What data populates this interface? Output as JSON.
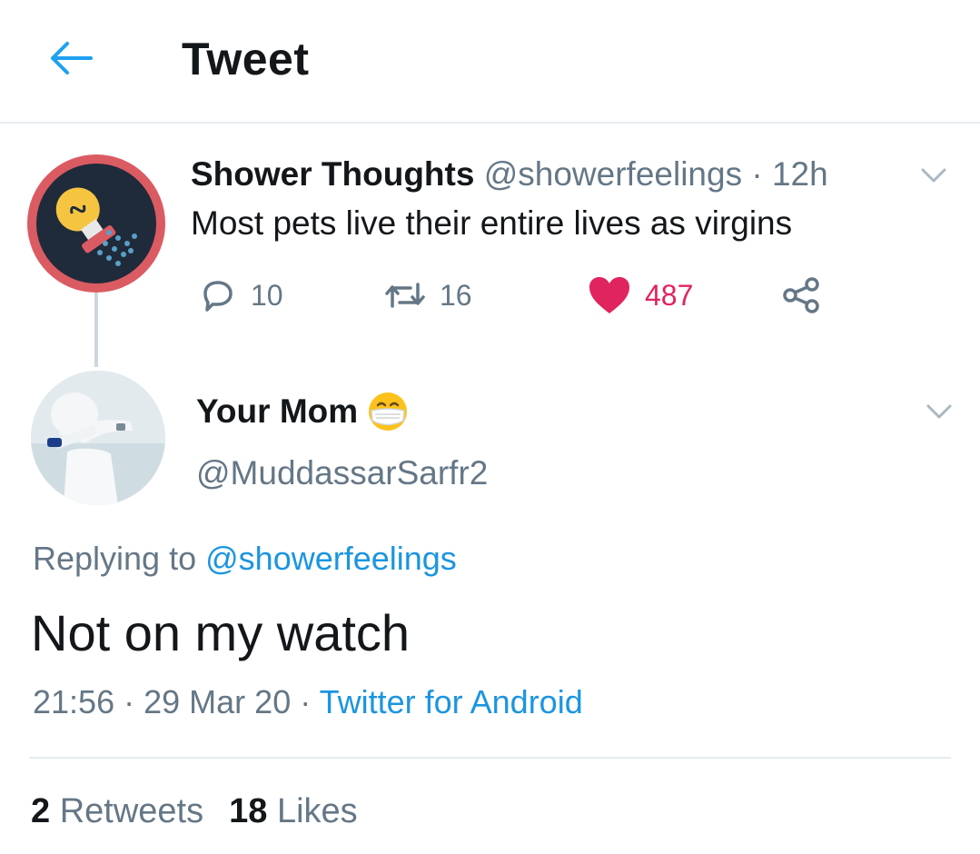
{
  "header": {
    "title": "Tweet",
    "back_icon": "arrow-left-icon",
    "accent": "#1da1f2"
  },
  "parent_tweet": {
    "name": "Shower Thoughts",
    "handle": "@showerfeelings",
    "separator": "·",
    "time": "12h",
    "text": "Most pets live their entire lives as virgins",
    "avatar_icon": "lightbulb-shower-icon",
    "avatar_colors": {
      "ring": "#db5b63",
      "inner": "#1f2b3a",
      "bulb": "#f5c542"
    },
    "actions": {
      "replies": "10",
      "retweets": "16",
      "likes": "487",
      "liked": true,
      "like_color": "#e0245e"
    }
  },
  "reply_tweet": {
    "name": "Your Mom",
    "name_emoji": "mask-face-emoji",
    "handle": "@MuddassarSarfr2",
    "replying_prefix": "Replying to",
    "replying_mention": "@showerfeelings",
    "text": "Not on my watch",
    "time": "21:56",
    "separator": "·",
    "date": "29 Mar 20",
    "source": "Twitter for Android",
    "link_color": "#1b95e0"
  },
  "stats": {
    "retweets_count": "2",
    "retweets_label": "Retweets",
    "likes_count": "18",
    "likes_label": "Likes"
  }
}
